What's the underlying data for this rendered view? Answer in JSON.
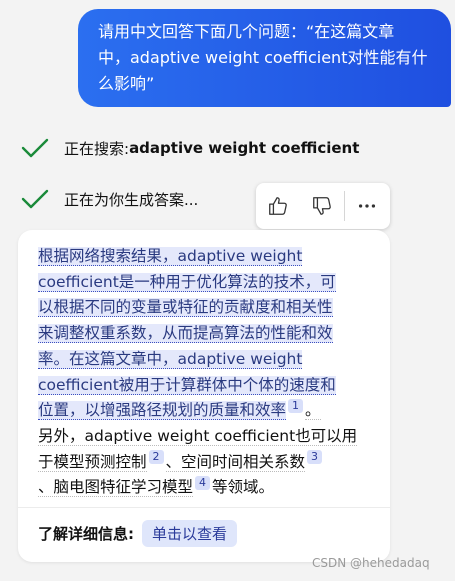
{
  "user_message": {
    "lines": [
      "请用中文回答下面几个问题：“在这篇文章",
      "中，adaptive weight coefficient对性能有什",
      "么影响”"
    ]
  },
  "status": {
    "searching_label": "正在搜索: ",
    "searching_query": "adaptive weight coefficient",
    "generating_label": "正在为你生成答案..."
  },
  "feedback": {
    "like_icon": "thumbs-up-icon",
    "dislike_icon": "thumbs-down-icon",
    "more_icon": "more-icon"
  },
  "answer": {
    "lines": [
      "根据网络搜索结果，adaptive weight",
      "coefficient是一种用于优化算法的技术，可",
      "以根据不同的变量或特征的贡献度和相关性",
      "来调整权重系数，从而提高算法的性能和效",
      "率。在这篇文章中，adaptive weight",
      "coefficient被用于计算群体中个体的速度和",
      "位置，以增强路径规划的质量和效率"
    ],
    "cite1": "1",
    "after_cite1": "。",
    "line8": "另外，adaptive weight coefficient也可以用",
    "line9_a": "于模型预测控制",
    "cite2": "2",
    "line9_b": "、空间时间相关系数",
    "cite3": "3",
    "line10_a": "、脑电图特征学习模型",
    "cite4": "4",
    "line10_b": "等领域。"
  },
  "learn_more": {
    "label": "了解详细信息:",
    "button": "单击以查看"
  },
  "watermark": "CSDN @hehedadaq",
  "colors": {
    "user_bubble": "#2b6ff0",
    "check": "#1a8a3a",
    "highlight_bg": "#e4e8fb",
    "citation_bg": "#d8dffa"
  }
}
